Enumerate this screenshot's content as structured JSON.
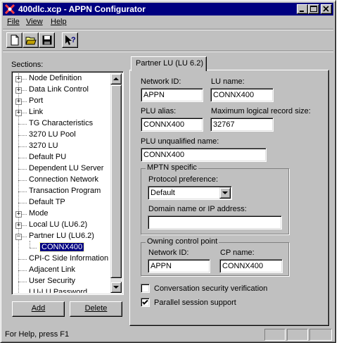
{
  "window": {
    "title": "400dlc.xcp - APPN Configurator"
  },
  "menu": {
    "file": "File",
    "view": "View",
    "help": "Help"
  },
  "toolbar": {
    "icons": [
      "new-document-icon",
      "open-folder-icon",
      "save-disk-icon",
      "context-help-icon"
    ]
  },
  "sections": {
    "label": "Sections:",
    "items": [
      {
        "label": "Node Definition",
        "expandable": true
      },
      {
        "label": "Data Link Control",
        "expandable": true
      },
      {
        "label": "Port",
        "expandable": true
      },
      {
        "label": "Link",
        "expandable": true
      },
      {
        "label": "TG Characteristics",
        "expandable": false
      },
      {
        "label": "3270 LU Pool",
        "expandable": false
      },
      {
        "label": "3270 LU",
        "expandable": false
      },
      {
        "label": "Default PU",
        "expandable": false
      },
      {
        "label": "Dependent LU Server",
        "expandable": false
      },
      {
        "label": "Connection Network",
        "expandable": false
      },
      {
        "label": "Transaction Program",
        "expandable": false
      },
      {
        "label": "Default TP",
        "expandable": false
      },
      {
        "label": "Mode",
        "expandable": true
      },
      {
        "label": "Local LU (LU6.2)",
        "expandable": true
      },
      {
        "label": "Partner LU (LU6.2)",
        "expandable": true,
        "expanded": true
      },
      {
        "label": "CONNX400",
        "child": true,
        "selected": true
      },
      {
        "label": "CPI-C Side Information",
        "expandable": false
      },
      {
        "label": "Adjacent Link",
        "expandable": false
      },
      {
        "label": "User Security",
        "expandable": false
      },
      {
        "label": "LU-LU Password",
        "expandable": false
      }
    ],
    "add_button": "Add",
    "delete_button": "Delete"
  },
  "tab": {
    "label": "Partner LU (LU 6.2)"
  },
  "form": {
    "network_id_label": "Network ID:",
    "network_id_value": "APPN",
    "lu_name_label": "LU name:",
    "lu_name_value": "CONNX400",
    "plu_alias_label": "PLU alias:",
    "plu_alias_value": "CONNX400",
    "max_record_label": "Maximum logical record size:",
    "max_record_value": "32767",
    "plu_unqualified_label": "PLU unqualified name:",
    "plu_unqualified_value": "CONNX400",
    "mptn": {
      "title": "MPTN specific",
      "protocol_label": "Protocol preference:",
      "protocol_value": "Default",
      "domain_label": "Domain name or IP address:",
      "domain_value": ""
    },
    "owning_cp": {
      "title": "Owning control point",
      "network_id_label": "Network ID:",
      "network_id_value": "APPN",
      "cp_name_label": "CP name:",
      "cp_name_value": "CONNX400"
    },
    "conv_security_label": "Conversation security verification",
    "conv_security_checked": false,
    "parallel_session_label": "Parallel session support",
    "parallel_session_checked": true
  },
  "status": {
    "text": "For Help, press F1"
  }
}
